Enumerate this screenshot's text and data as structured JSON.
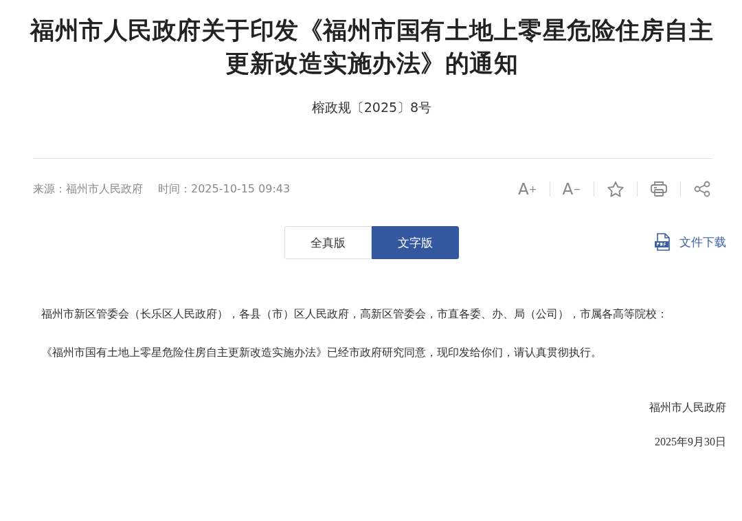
{
  "article": {
    "title": "福州市人民政府关于印发《福州市国有土地上零星危险住房自主更新改造实施办法》的通知",
    "doc_number": "榕政规〔2025〕8号",
    "source_label": "来源：福州市人民政府",
    "time_label": "时间：2025-10-15 09:43"
  },
  "tools": [
    {
      "kind": "font-up",
      "label": "A",
      "mark": "+"
    },
    {
      "kind": "font-down",
      "label": "A",
      "mark": "−"
    },
    {
      "kind": "star"
    },
    {
      "kind": "print"
    },
    {
      "kind": "share"
    }
  ],
  "version_tabs": [
    {
      "label": "全真版",
      "selected": false
    },
    {
      "label": "文字版",
      "selected": true
    }
  ],
  "download": {
    "label": "文件下载"
  },
  "body": {
    "paragraphs": [
      "福州市新区管委会（长乐区人民政府），各县（市）区人民政府，高新区管委会，市直各委、办、局（公司），市属各高等院校：",
      "《福州市国有土地上零星危险住房自主更新改造实施办法》已经市政府研究同意，现印发给你们，请认真贯彻执行。"
    ],
    "signature": "福州市人民政府",
    "date": "2025年9月30日"
  }
}
